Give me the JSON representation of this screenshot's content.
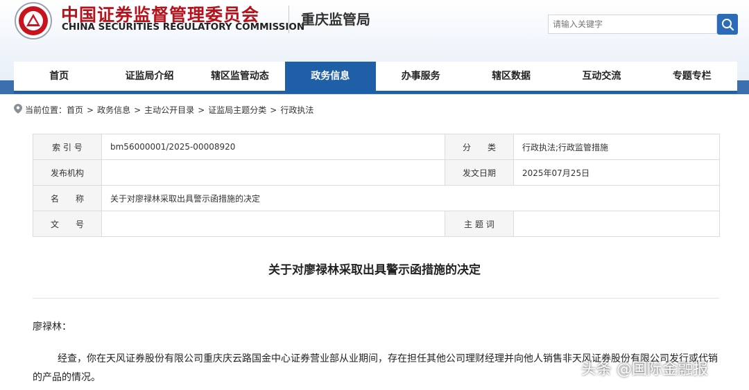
{
  "header": {
    "brand_cn": "中国证券监督管理委员会",
    "brand_en": "CHINA SECURITIES REGULATORY COMMISSION",
    "bureau": "重庆监管局",
    "search_placeholder": "请输入关键字"
  },
  "nav": {
    "items": [
      "首页",
      "证监局介绍",
      "辖区监管动态",
      "政务信息",
      "办事服务",
      "辖区数据",
      "互动交流",
      "专题专栏"
    ],
    "active": "政务信息"
  },
  "breadcrumb": {
    "prefix": "当前位置：",
    "items": [
      "首页",
      "政务信息",
      "主动公开目录",
      "证监局主题分类",
      "行政执法"
    ],
    "separator": ">"
  },
  "meta": {
    "index_label": "索 引 号",
    "index_value": "bm56000001/2025-00008920",
    "category_label": "分　　类",
    "category_value": "行政执法;行政监管措施",
    "publisher_label": "发布机构",
    "publisher_value": "",
    "date_label": "发文日期",
    "date_value": "2025年07月25日",
    "name_label": "名　　称",
    "name_value": "关于对廖禄林采取出具警示函措施的决定",
    "docno_label": "文　　号",
    "docno_value": "",
    "topic_label": "主 题 词",
    "topic_value": ""
  },
  "document": {
    "title": "关于对廖禄林采取出具警示函措施的决定",
    "salutation": "廖禄林：",
    "paragraph1": "经查，你在天风证券股份有限公司重庆庆云路国金中心证券营业部从业期间，存在担任其他公司理财经理并向他人销售非天风证券股份有限公司发行或代销的产品的情况。"
  },
  "watermark": "头条 @国际金融报",
  "colors": {
    "brand_red": "#b5121b",
    "nav_active": "#1f5fa8",
    "band_blue": "#3b6fae",
    "search_button": "#2b6bb8"
  },
  "icons": {
    "logo": "csrc-emblem",
    "search": "search-icon",
    "location": "location-pin-icon"
  }
}
